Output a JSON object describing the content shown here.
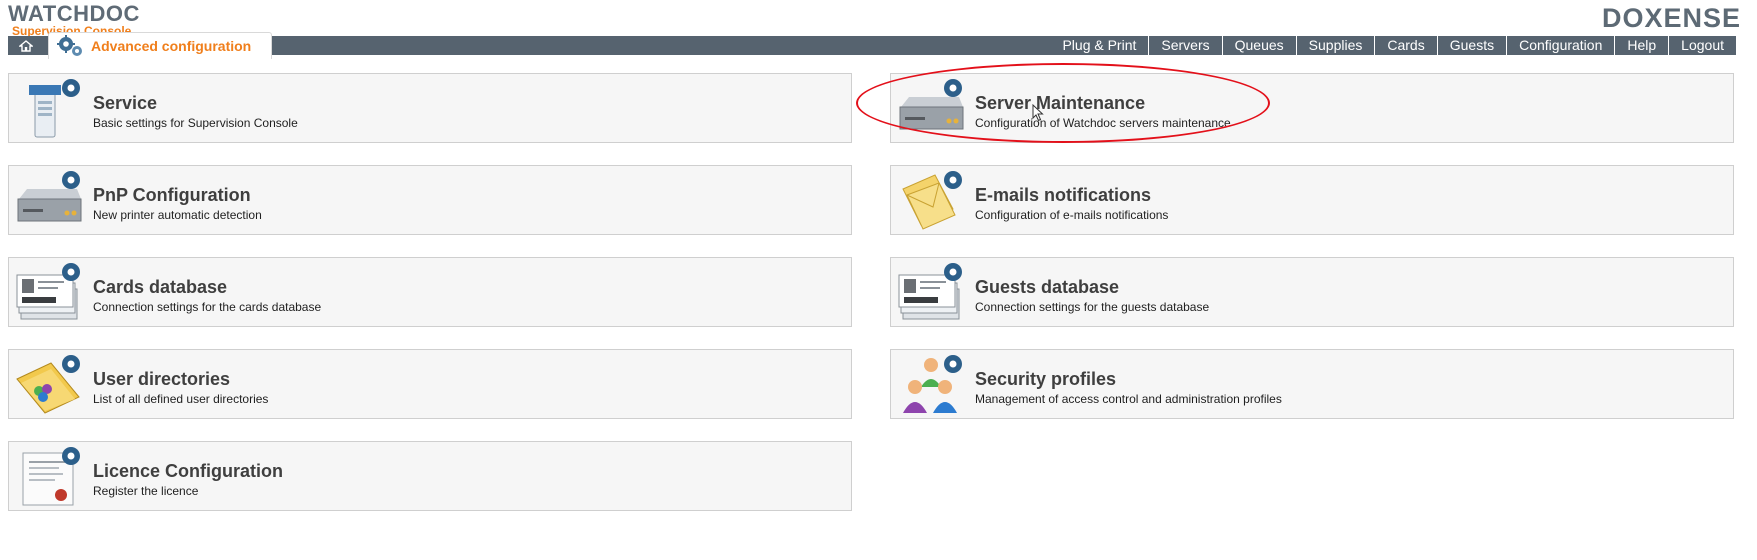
{
  "header": {
    "brand": "WATCHDOC",
    "subtitle": "Supervision Console",
    "vendor": "DOXENSE"
  },
  "breadcrumb": {
    "home_icon": "home-icon",
    "section": "Advanced configuration"
  },
  "nav": [
    "Plug & Print",
    "Servers",
    "Queues",
    "Supplies",
    "Cards",
    "Guests",
    "Configuration",
    "Help",
    "Logout"
  ],
  "tiles": [
    {
      "title": "Service",
      "desc": "Basic settings for Supervision Console",
      "icon": "service-gear-icon"
    },
    {
      "title": "Server Maintenance",
      "desc": "Configuration of Watchdoc servers maintenance",
      "icon": "server-gear-icon"
    },
    {
      "title": "PnP Configuration",
      "desc": "New printer automatic detection",
      "icon": "printer-gear-icon"
    },
    {
      "title": "E-mails notifications",
      "desc": "Configuration of e-mails notifications",
      "icon": "envelope-gear-icon"
    },
    {
      "title": "Cards database",
      "desc": "Connection settings for the cards database",
      "icon": "cards-gear-icon"
    },
    {
      "title": "Guests database",
      "desc": "Connection settings for the guests database",
      "icon": "guests-cards-gear-icon"
    },
    {
      "title": "User directories",
      "desc": "List of all defined user directories",
      "icon": "directory-book-gear-icon"
    },
    {
      "title": "Security profiles",
      "desc": "Management of access control and administration profiles",
      "icon": "users-gear-icon"
    },
    {
      "title": "Licence Configuration",
      "desc": "Register the licence",
      "icon": "certificate-gear-icon"
    }
  ],
  "colors": {
    "accent": "#f07f1c",
    "navbar": "#56636f",
    "highlight": "#e3101a"
  }
}
